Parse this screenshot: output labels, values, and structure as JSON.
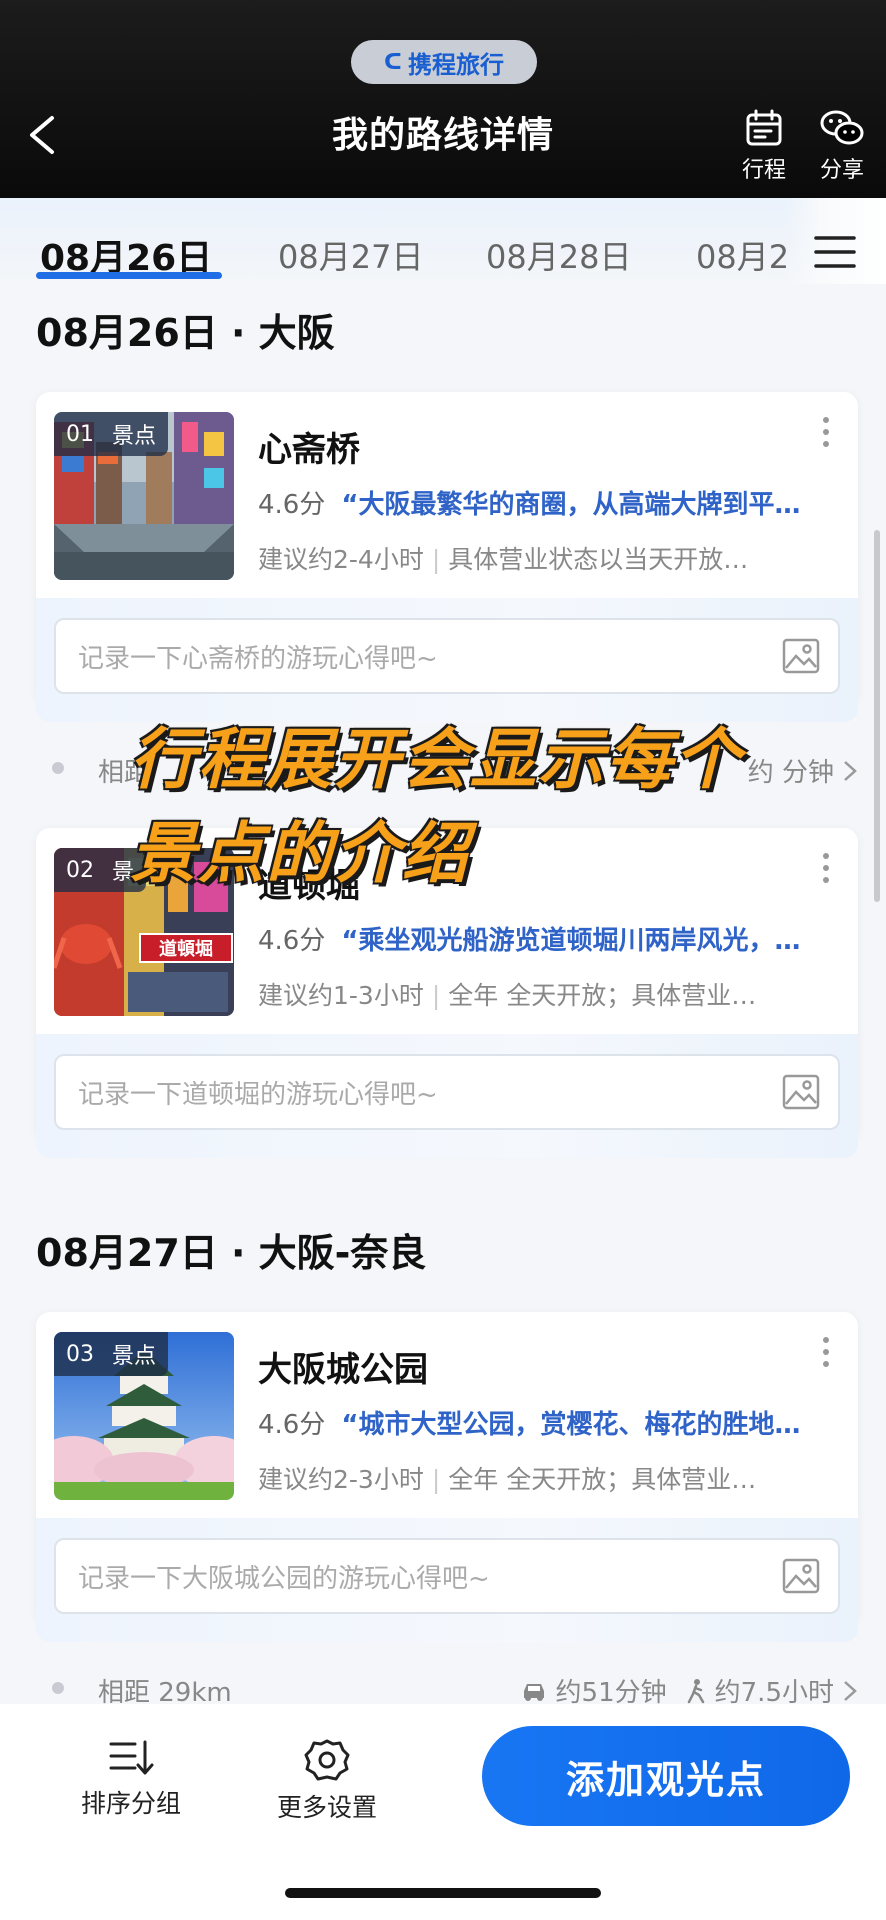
{
  "watermark": {
    "brand": "携程旅行"
  },
  "header": {
    "title": "我的路线详情",
    "actions": [
      {
        "label": "行程",
        "icon": "calendar-icon"
      },
      {
        "label": "分享",
        "icon": "wechat-icon"
      }
    ]
  },
  "date_tabs": [
    "08月26日",
    "08月27日",
    "08月28日",
    "08月2"
  ],
  "days": [
    {
      "header": "08月26日 · 大阪"
    },
    {
      "header": "08月27日 · 大阪-奈良"
    }
  ],
  "spots": [
    {
      "index": "01",
      "type": "景点",
      "name": "心斋桥",
      "score": "4.6分",
      "quote": "“大阪最繁华的商圈，从高端大牌到平…",
      "duration": "建议约2-4小时",
      "hours": "具体营业状态以当天开放…",
      "note_placeholder": "记录一下心斋桥的游玩心得吧~"
    },
    {
      "index": "02",
      "type": "景",
      "name": "道顿堀",
      "score": "4.6分",
      "quote": "“乘坐观光船游览道顿堀川两岸风光，…",
      "duration": "建议约1-3小时",
      "hours": "全年 全天开放；具体营业…",
      "note_placeholder": "记录一下道顿堀的游玩心得吧~"
    },
    {
      "index": "03",
      "type": "景点",
      "name": "大阪城公园",
      "score": "4.6分",
      "quote": "“城市大型公园，赏樱花、梅花的胜地…",
      "duration": "建议约2-3小时",
      "hours": "全年 全天开放；具体营业…",
      "note_placeholder": "记录一下大阪城公园的游玩心得吧~"
    }
  ],
  "distances": [
    {
      "left": "相距",
      "right": "约   分钟"
    },
    {
      "left": "相距 29km",
      "car": "约51分钟",
      "walk": "约7.5小时"
    }
  ],
  "caption": {
    "line1": "行程展开会显示每个",
    "line2": "景点的介绍"
  },
  "bottom": {
    "sort_label": "排序分组",
    "settings_label": "更多设置",
    "add_label": "添加观光点"
  },
  "colors": {
    "accent": "#1f6ee6",
    "quote": "#2f63c7",
    "caption": "#f7a11a"
  }
}
